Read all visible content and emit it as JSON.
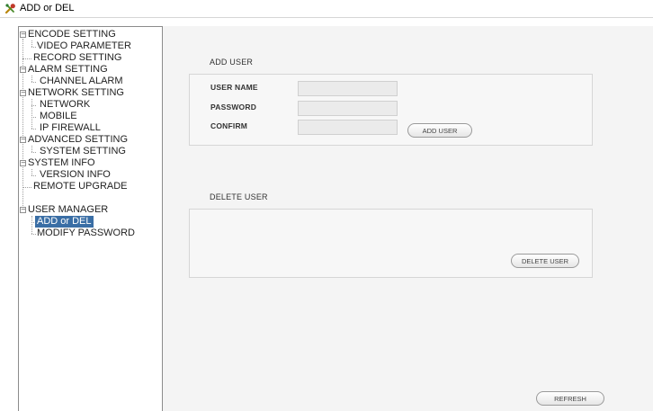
{
  "window": {
    "title": "ADD or DEL",
    "icon": "tools-icon"
  },
  "tree": {
    "items": [
      {
        "label": "ENCODE SETTING"
      },
      {
        "label": "VIDEO PARAMETER"
      },
      {
        "label": "RECORD SETTING"
      },
      {
        "label": "ALARM SETTING"
      },
      {
        "label": "CHANNEL ALARM"
      },
      {
        "label": "NETWORK SETTING"
      },
      {
        "label": "NETWORK"
      },
      {
        "label": "MOBILE"
      },
      {
        "label": "IP FIREWALL"
      },
      {
        "label": "ADVANCED SETTING"
      },
      {
        "label": "SYSTEM SETTING"
      },
      {
        "label": "SYSTEM INFO"
      },
      {
        "label": "VERSION INFO"
      },
      {
        "label": "REMOTE UPGRADE"
      },
      {
        "label": "USER MANAGER"
      },
      {
        "label": "ADD or DEL"
      },
      {
        "label": "MODIFY PASSWORD"
      }
    ],
    "selected": "ADD or DEL",
    "selection_color": "#3a6ea5"
  },
  "add_user": {
    "title": "ADD USER",
    "username_label": "USER NAME",
    "username_value": "",
    "password_label": "PASSWORD",
    "password_value": "",
    "confirm_label": "CONFIRM",
    "confirm_value": "",
    "add_button": "ADD USER"
  },
  "delete_user": {
    "title": "DELETE USER",
    "delete_button": "DELETE USER"
  },
  "refresh_button": "REFRESH"
}
